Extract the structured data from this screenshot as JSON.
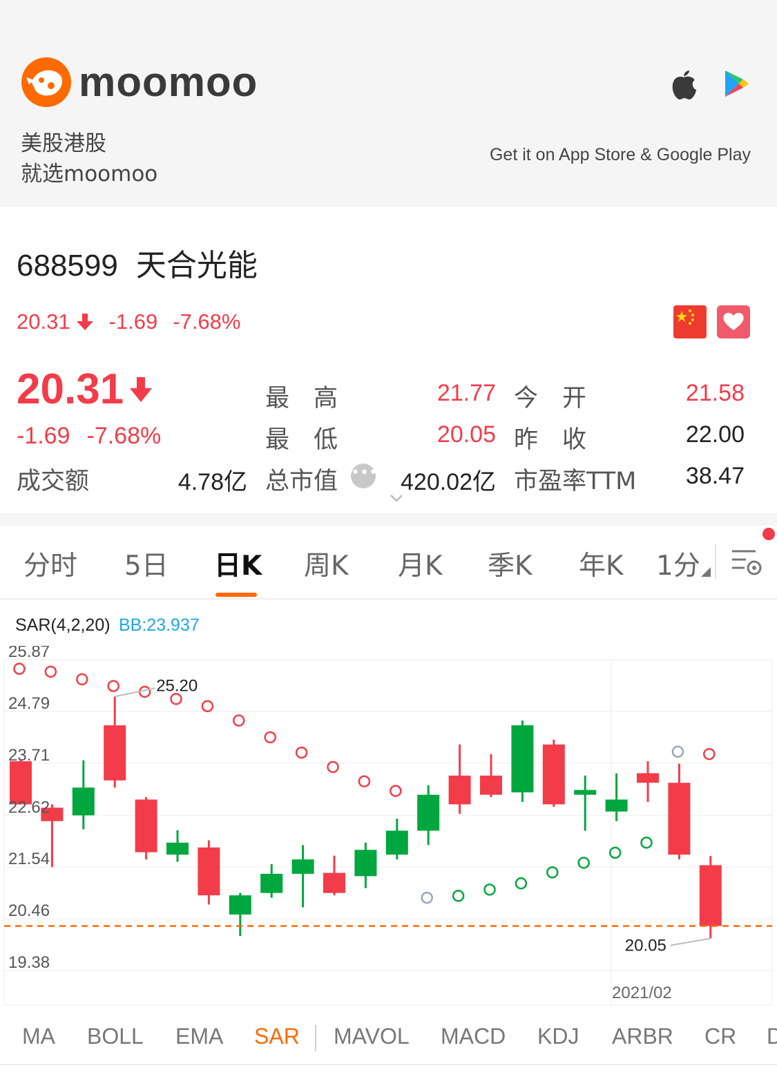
{
  "banner": {
    "logo_text": "moomoo",
    "slogan_line1": "美股港股",
    "slogan_line2": "就选moomoo",
    "store_text": "Get it on App Store & Google Play"
  },
  "stock": {
    "code": "688599",
    "name": "天合光能",
    "price": "20.31",
    "change": "-1.69",
    "change_pct": "-7.68%"
  },
  "quote": {
    "high_label": "最　高",
    "high": "21.77",
    "open_label": "今　开",
    "open": "21.58",
    "low_label": "最　低",
    "low": "20.05",
    "prev_close_label": "昨　收",
    "prev_close": "22.00",
    "turnover_label": "成交额",
    "turnover": "4.78亿",
    "mktcap_label": "总市值",
    "mktcap": "420.02亿",
    "pe_label": "市盈率TTM",
    "pe": "38.47",
    "more_icon": "more-dots-icon"
  },
  "tabs": [
    {
      "label": "分时"
    },
    {
      "label": "5日"
    },
    {
      "label": "日K"
    },
    {
      "label": "周K"
    },
    {
      "label": "月K"
    },
    {
      "label": "季K"
    },
    {
      "label": "年K"
    },
    {
      "label": "1分"
    }
  ],
  "active_tab": "日K",
  "indicator_header": {
    "name": "SAR(4,2,20)",
    "bb": "BB:23.937"
  },
  "indicators": [
    "MA",
    "BOLL",
    "EMA",
    "SAR",
    "MAVOL",
    "MACD",
    "KDJ",
    "ARBR",
    "CR",
    "D"
  ],
  "active_indicator": "SAR",
  "colors": {
    "up": "#f23c4a",
    "down": "#00a63e",
    "accent": "#ff6a00",
    "bb": "#1ea7e4",
    "sar_transition": "#9aa5b8"
  },
  "chart_data": {
    "type": "candlestick",
    "y_ticks": [
      "25.87",
      "24.79",
      "23.71",
      "22.62",
      "21.54",
      "20.46",
      "19.38"
    ],
    "ylim": [
      19.38,
      25.87
    ],
    "date_label": "2021/02",
    "max_label": "25.20",
    "min_label": "20.05",
    "reference_line": 20.31,
    "candles": [
      {
        "open": 22.85,
        "close": 23.75,
        "high": 23.78,
        "low": 22.85,
        "dir": "up"
      },
      {
        "open": 22.5,
        "close": 22.78,
        "high": 22.85,
        "low": 21.54,
        "dir": "up"
      },
      {
        "open": 23.2,
        "close": 22.62,
        "high": 23.77,
        "low": 22.33,
        "dir": "down"
      },
      {
        "open": 23.35,
        "close": 24.5,
        "high": 25.1,
        "low": 23.2,
        "dir": "up"
      },
      {
        "open": 21.85,
        "close": 22.95,
        "high": 23.0,
        "low": 21.7,
        "dir": "up"
      },
      {
        "open": 22.05,
        "close": 21.8,
        "high": 22.31,
        "low": 21.65,
        "dir": "down"
      },
      {
        "open": 20.95,
        "close": 21.95,
        "high": 22.1,
        "low": 20.76,
        "dir": "up"
      },
      {
        "open": 20.95,
        "close": 20.55,
        "high": 21.0,
        "low": 20.1,
        "dir": "down"
      },
      {
        "open": 21.0,
        "close": 21.4,
        "high": 21.6,
        "low": 20.9,
        "dir": "down"
      },
      {
        "open": 21.4,
        "close": 21.7,
        "high": 22.0,
        "low": 20.7,
        "dir": "down"
      },
      {
        "open": 21.0,
        "close": 21.42,
        "high": 21.78,
        "low": 20.95,
        "dir": "up"
      },
      {
        "open": 21.35,
        "close": 21.9,
        "high": 22.05,
        "low": 21.1,
        "dir": "down"
      },
      {
        "open": 21.8,
        "close": 22.3,
        "high": 22.55,
        "low": 21.7,
        "dir": "down"
      },
      {
        "open": 22.3,
        "close": 23.05,
        "high": 23.25,
        "low": 22.0,
        "dir": "down"
      },
      {
        "open": 22.85,
        "close": 23.45,
        "high": 24.1,
        "low": 22.65,
        "dir": "up"
      },
      {
        "open": 23.05,
        "close": 23.45,
        "high": 23.9,
        "low": 23.0,
        "dir": "up"
      },
      {
        "open": 24.5,
        "close": 23.1,
        "high": 24.6,
        "low": 22.9,
        "dir": "down"
      },
      {
        "open": 22.85,
        "close": 24.1,
        "high": 24.2,
        "low": 22.8,
        "dir": "up"
      },
      {
        "open": 23.15,
        "close": 23.05,
        "high": 23.45,
        "low": 22.3,
        "dir": "down"
      },
      {
        "open": 22.95,
        "close": 22.7,
        "high": 23.5,
        "low": 22.5,
        "dir": "down"
      },
      {
        "open": 23.3,
        "close": 23.5,
        "high": 23.75,
        "low": 22.9,
        "dir": "up"
      },
      {
        "open": 21.8,
        "close": 23.3,
        "high": 23.7,
        "low": 21.7,
        "dir": "up"
      },
      {
        "open": 20.31,
        "close": 21.58,
        "high": 21.77,
        "low": 20.05,
        "dir": "up"
      }
    ],
    "sar": [
      {
        "i": 0,
        "v": 25.68,
        "dir": "up"
      },
      {
        "i": 1,
        "v": 25.62,
        "dir": "up"
      },
      {
        "i": 2,
        "v": 25.46,
        "dir": "up"
      },
      {
        "i": 3,
        "v": 25.32,
        "dir": "up"
      },
      {
        "i": 4,
        "v": 25.2,
        "dir": "up"
      },
      {
        "i": 5,
        "v": 25.05,
        "dir": "up"
      },
      {
        "i": 6,
        "v": 24.9,
        "dir": "up"
      },
      {
        "i": 7,
        "v": 24.6,
        "dir": "up"
      },
      {
        "i": 8,
        "v": 24.25,
        "dir": "up"
      },
      {
        "i": 9,
        "v": 23.93,
        "dir": "up"
      },
      {
        "i": 10,
        "v": 23.63,
        "dir": "up"
      },
      {
        "i": 11,
        "v": 23.33,
        "dir": "up"
      },
      {
        "i": 12,
        "v": 23.13,
        "dir": "up"
      },
      {
        "i": 13,
        "v": 20.9,
        "dir": "turn"
      },
      {
        "i": 14,
        "v": 20.94,
        "dir": "down"
      },
      {
        "i": 15,
        "v": 21.07,
        "dir": "down"
      },
      {
        "i": 16,
        "v": 21.2,
        "dir": "down"
      },
      {
        "i": 17,
        "v": 21.43,
        "dir": "down"
      },
      {
        "i": 18,
        "v": 21.63,
        "dir": "down"
      },
      {
        "i": 19,
        "v": 21.84,
        "dir": "down"
      },
      {
        "i": 20,
        "v": 22.05,
        "dir": "down"
      },
      {
        "i": 21,
        "v": 23.95,
        "dir": "turn"
      },
      {
        "i": 22,
        "v": 23.9,
        "dir": "up"
      }
    ]
  }
}
